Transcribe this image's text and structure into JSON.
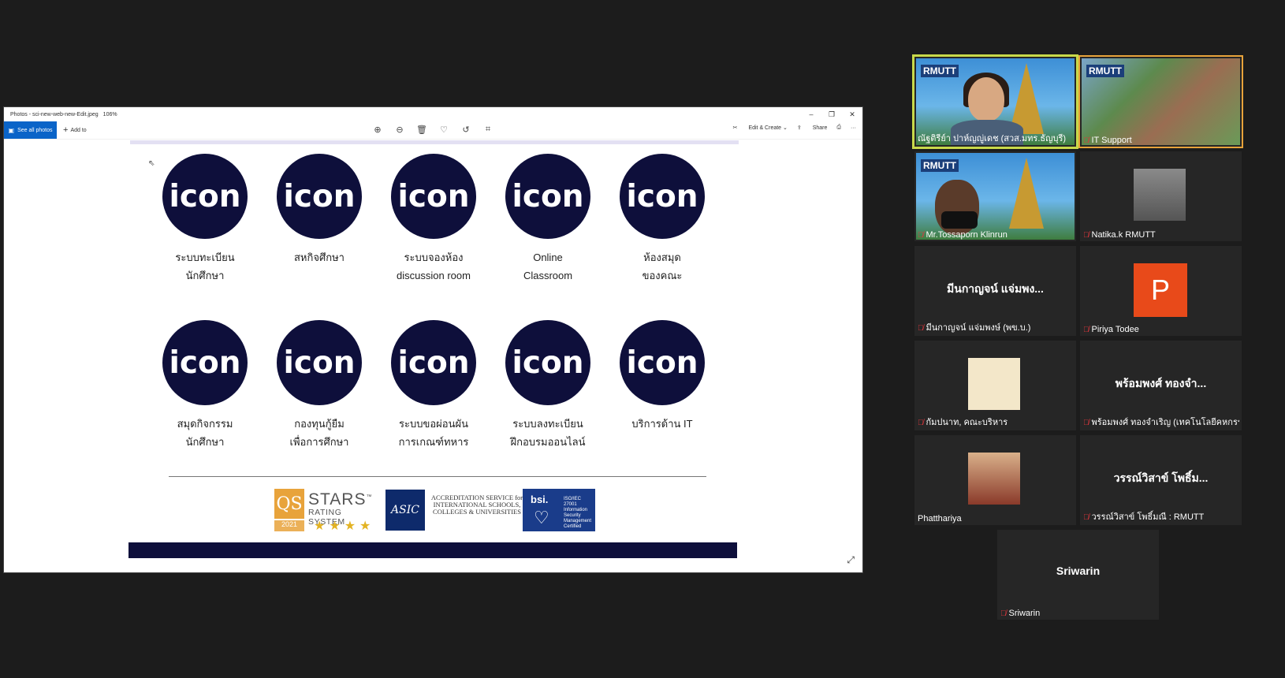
{
  "photos_window": {
    "title": "Photos - sci-new-web-new-Edit.jpeg",
    "zoom": "106%",
    "minimize": "–",
    "restore": "❐",
    "close": "✕",
    "see_all_photos": "See all photos",
    "add_to": "Add to",
    "edit_create": "Edit & Create",
    "share": "Share",
    "more": "···"
  },
  "icon_text": "icon",
  "services": [
    {
      "line1": "ระบบทะเบียน",
      "line2": "นักศึกษา"
    },
    {
      "line1": "สหกิจศึกษา",
      "line2": ""
    },
    {
      "line1": "ระบบจองห้อง",
      "line2": "discussion room"
    },
    {
      "line1": "Online",
      "line2": "Classroom"
    },
    {
      "line1": "ห้องสมุด",
      "line2": "ของคณะ"
    },
    {
      "line1": "สมุดกิจกรรม",
      "line2": "นักศึกษา"
    },
    {
      "line1": "กองทุนกู้ยืม",
      "line2": "เพื่อการศึกษา"
    },
    {
      "line1": "ระบบขอผ่อนผัน",
      "line2": "การเกณฑ์ทหาร"
    },
    {
      "line1": "ระบบลงทะเบียน",
      "line2": "ฝึกอบรมออนไลน์"
    },
    {
      "line1": "บริการด้าน IT",
      "line2": ""
    }
  ],
  "logos": {
    "qs": "QS",
    "qs_year": "2021",
    "stars": "STARS",
    "tm": "™",
    "rating": "RATING SYSTEM",
    "asic": "ASIC",
    "asic_text": "ACCREDITATION SERVICE for INTERNATIONAL SCHOOLS, COLLEGES & UNIVERSITIES",
    "bsi": "bsi.",
    "bsi_text": "ISO/IEC 27001 Information Security Management Certified"
  },
  "participants": [
    {
      "name": "ณัฐติรีย์า ปาห์ญญู่เดช (สวส.มทร.ธัญบุรี)",
      "active": true
    },
    {
      "name": "IT Support"
    },
    {
      "name": "Mr.Tossaporn Klinrun"
    },
    {
      "name": "Natika.k RMUTT"
    },
    {
      "name": "มีนกาญจน์ แจ่มพงษ์ (พข.บ.)",
      "big": "มีนกาญจน์ แจ่มพง..."
    },
    {
      "name": "Piriya Todee",
      "initial": "P"
    },
    {
      "name": "กัมปนาท, คณะบริหาร"
    },
    {
      "name": "พร้อมพงศ์ ทองจำเริญ (เทคโนโลยีคหกรรม...",
      "big": "พร้อมพงศ์ ทองจำ..."
    },
    {
      "name": "Phatthariya"
    },
    {
      "name": "วรรณ์วิสาข์ โพธิ์มณี : RMUTT",
      "big": "วรรณ์วิสาข์ โพธิ์ม..."
    },
    {
      "name": "Sriwarin",
      "big": "Sriwarin"
    }
  ],
  "rmutt_logo": "RMUTT",
  "colors": {
    "icon_bg": "#0e0f3b",
    "accent_blue": "#0a64c8",
    "active_speaker": "#c8d94a",
    "piriya_avatar": "#e84a1a"
  }
}
